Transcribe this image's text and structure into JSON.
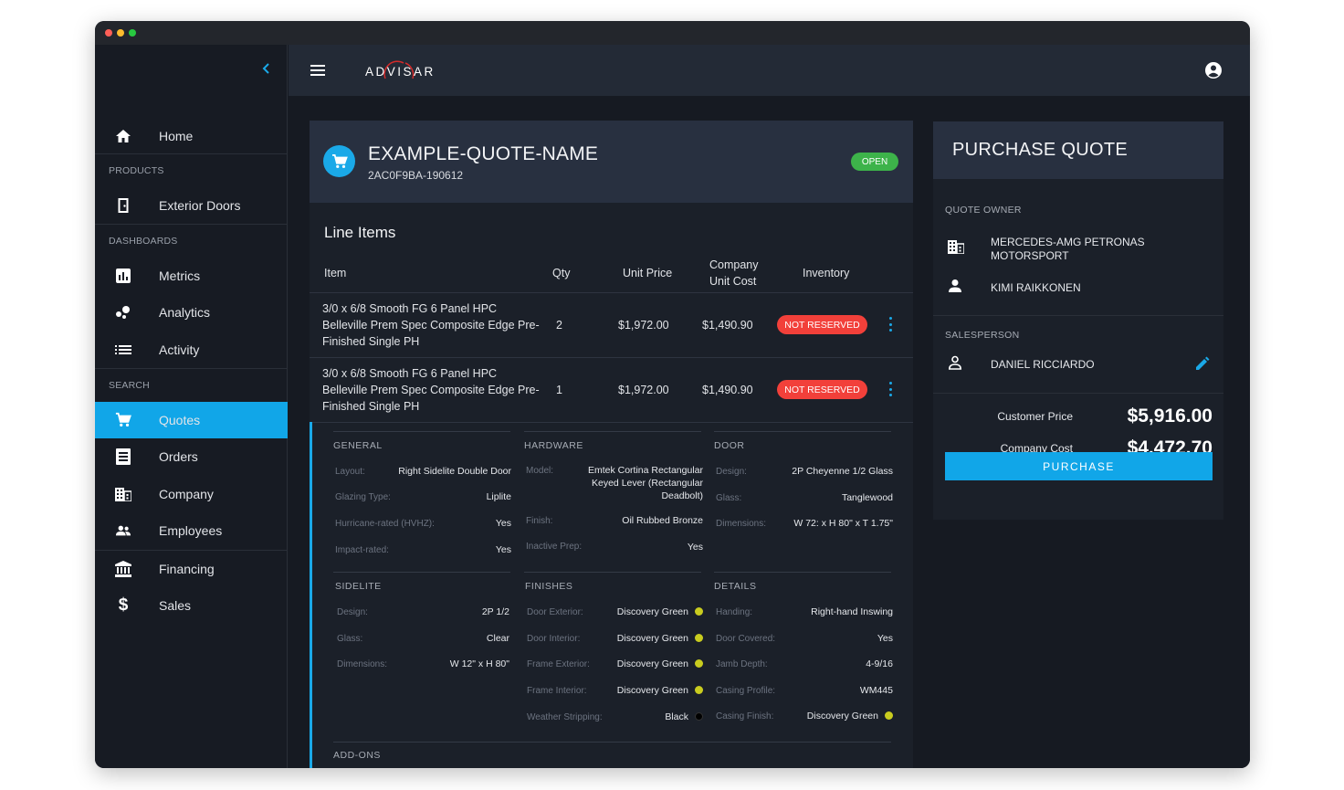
{
  "sidebar": {
    "items": [
      {
        "label": "Home",
        "icon": "home-icon"
      },
      {
        "label": "Exterior Doors",
        "icon": "door-icon"
      },
      {
        "label": "Metrics",
        "icon": "bar-chart-icon"
      },
      {
        "label": "Analytics",
        "icon": "bubble-chart-icon"
      },
      {
        "label": "Activity",
        "icon": "list-icon"
      },
      {
        "label": "Quotes",
        "icon": "cart-icon"
      },
      {
        "label": "Orders",
        "icon": "receipt-icon"
      },
      {
        "label": "Company",
        "icon": "building-icon"
      },
      {
        "label": "Employees",
        "icon": "people-icon"
      },
      {
        "label": "Financing",
        "icon": "bank-icon"
      },
      {
        "label": "Sales",
        "icon": "dollar-icon"
      }
    ],
    "sections": {
      "products": "PRODUCTS",
      "dashboards": "DASHBOARDS",
      "search": "SEARCH"
    },
    "active": "Quotes"
  },
  "header": {
    "brand": "ADVISAR"
  },
  "quote": {
    "name": "EXAMPLE-QUOTE-NAME",
    "id": "2AC0F9BA-190612",
    "status": "OPEN",
    "line_items_title": "Line Items",
    "columns": {
      "item": "Item",
      "qty": "Qty",
      "unit_price": "Unit Price",
      "company_unit_cost_1": "Company",
      "company_unit_cost_2": "Unit Cost",
      "inventory": "Inventory"
    },
    "rows": [
      {
        "item_1": "3/0 x 6/8 Smooth FG 6 Panel HPC",
        "item_2": "Belleville Prem Spec Composite Edge Pre-",
        "item_3": "Finished Single PH",
        "qty": "2",
        "unit_price": "$1,972.00",
        "cost": "$1,490.90",
        "inventory": "NOT RESERVED"
      },
      {
        "item_1": "3/0 x 6/8 Smooth FG 6 Panel HPC",
        "item_2": "Belleville Prem Spec Composite Edge Pre-",
        "item_3": "Finished Single PH",
        "qty": "1",
        "unit_price": "$1,972.00",
        "cost": "$1,490.90",
        "inventory": "NOT RESERVED"
      }
    ],
    "details": {
      "general": {
        "title": "GENERAL",
        "fields": [
          {
            "label": "Layout:",
            "value": "Right Sidelite Double Door"
          },
          {
            "label": "Glazing Type:",
            "value": "Liplite"
          },
          {
            "label": "Hurricane-rated (HVHZ):",
            "value": "Yes"
          },
          {
            "label": "Impact-rated:",
            "value": "Yes"
          }
        ]
      },
      "hardware": {
        "title": "HARDWARE",
        "fields": [
          {
            "label": "Model:",
            "value_1": "Emtek Cortina Rectangular",
            "value_2": "Keyed Lever (Rectangular",
            "value_3": "Deadbolt)"
          },
          {
            "label": "Finish:",
            "value": "Oil Rubbed Bronze"
          },
          {
            "label": "Inactive Prep:",
            "value": "Yes"
          }
        ]
      },
      "door": {
        "title": "DOOR",
        "fields": [
          {
            "label": "Design:",
            "value": "2P Cheyenne 1/2 Glass"
          },
          {
            "label": "Glass:",
            "value": "Tanglewood"
          },
          {
            "label": "Dimensions:",
            "value": "W 72: x H 80\" x T 1.75\""
          }
        ]
      },
      "sidelite": {
        "title": "SIDELITE",
        "fields": [
          {
            "label": "Design:",
            "value": "2P 1/2"
          },
          {
            "label": "Glass:",
            "value": "Clear"
          },
          {
            "label": "Dimensions:",
            "value": "W 12\" x H 80\""
          }
        ]
      },
      "finishes": {
        "title": "FINISHES",
        "fields": [
          {
            "label": "Door Exterior:",
            "value": "Discovery Green",
            "color": "#c9cc1f"
          },
          {
            "label": "Door Interior:",
            "value": "Discovery Green",
            "color": "#c9cc1f"
          },
          {
            "label": "Frame Exterior:",
            "value": "Discovery Green",
            "color": "#c9cc1f"
          },
          {
            "label": "Frame Interior:",
            "value": "Discovery Green",
            "color": "#c9cc1f"
          },
          {
            "label": "Weather Stripping:",
            "value": "Black",
            "color": "#000000"
          }
        ]
      },
      "details": {
        "title": "DETAILS",
        "fields": [
          {
            "label": "Handing:",
            "value": "Right-hand Inswing"
          },
          {
            "label": "Door Covered:",
            "value": "Yes"
          },
          {
            "label": "Jamb Depth:",
            "value": "4-9/16"
          },
          {
            "label": "Casing Profile:",
            "value": "WM445"
          },
          {
            "label": "Casing Finish:",
            "value": "Discovery Green",
            "color": "#c9cc1f"
          }
        ]
      },
      "addons": {
        "title": "ADD-ONS"
      }
    }
  },
  "purchase": {
    "title": "PURCHASE QUOTE",
    "owner_label": "QUOTE OWNER",
    "company_1": "MERCEDES-AMG PETRONAS",
    "company_2": "MOTORSPORT",
    "owner": "KIMI RAIKKONEN",
    "salesperson_label": "SALESPERSON",
    "salesperson": "DANIEL RICCIARDO",
    "customer_price_label": "Customer Price",
    "customer_price": "$5,916.00",
    "company_cost_label": "Company Cost",
    "company_cost": "$4,472.70",
    "button": "PURCHASE"
  },
  "colors": {
    "accent": "#11a6e8",
    "open": "#3db34a",
    "not_reserved": "#f2403a"
  }
}
